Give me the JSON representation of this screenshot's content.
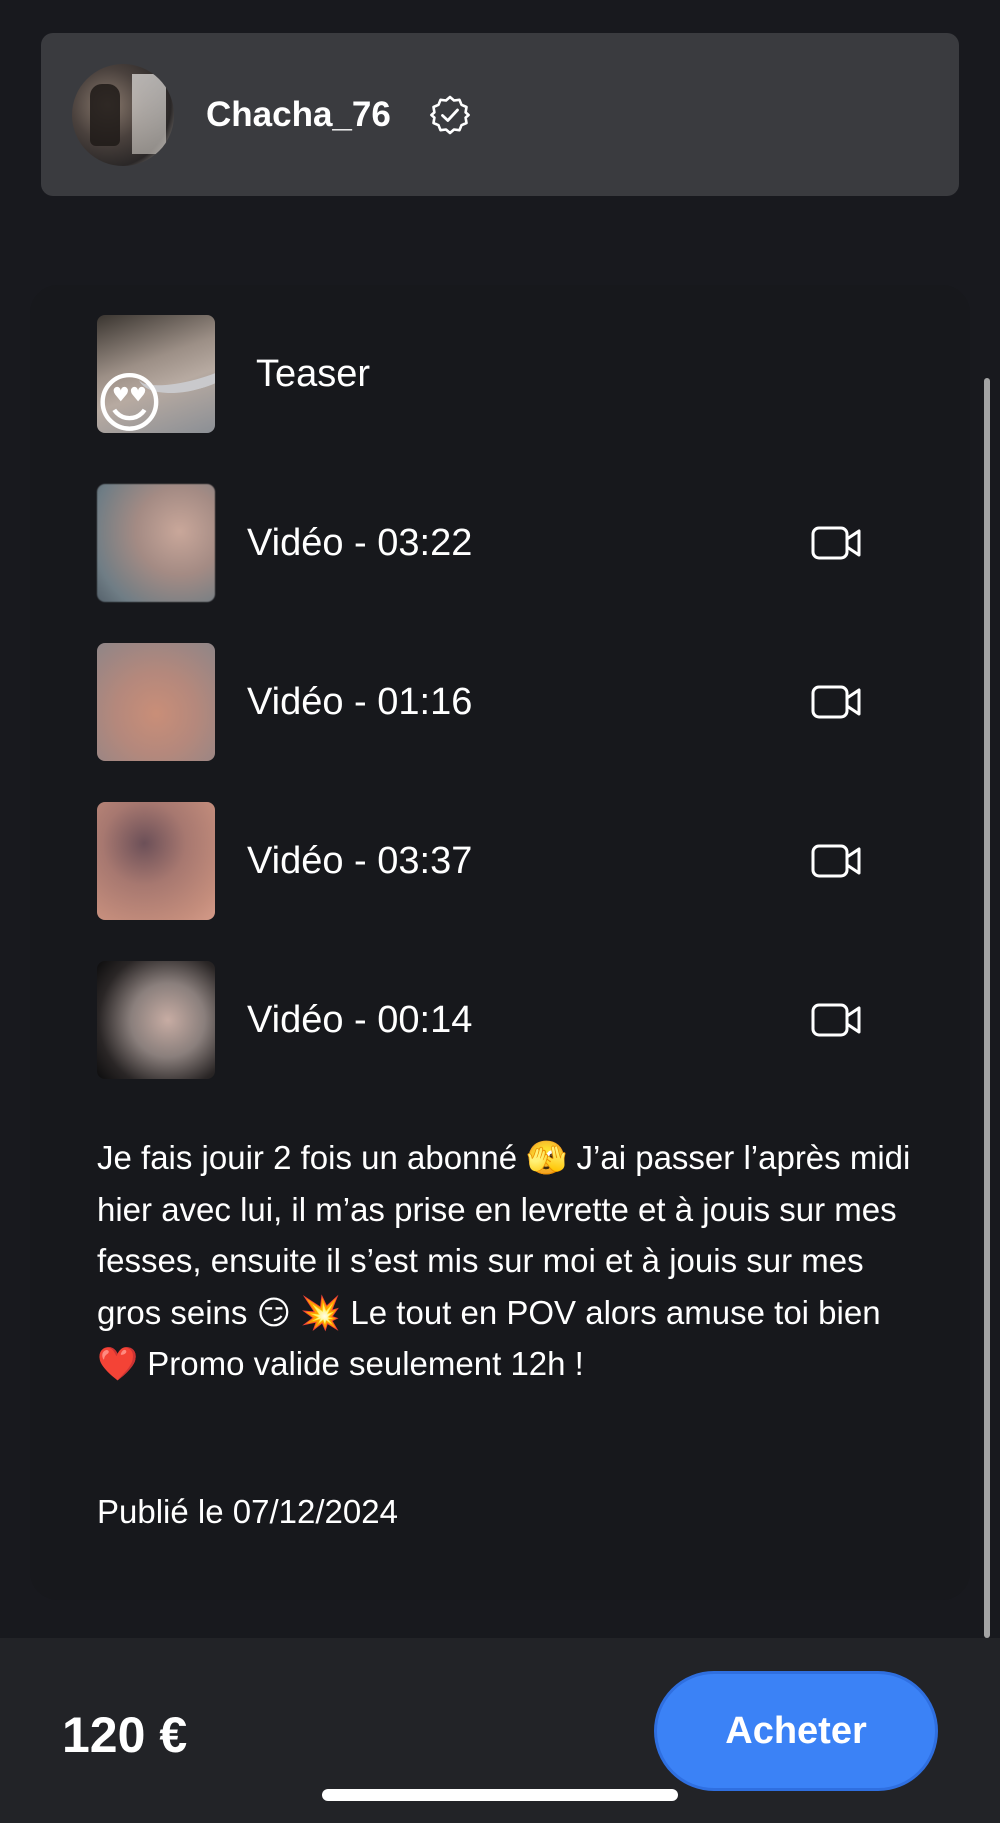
{
  "creator": {
    "username": "Chacha_76",
    "verified_icon": "verified-badge-icon"
  },
  "media": {
    "teaser_label": "Teaser",
    "teaser_emoji": "😍",
    "videos": [
      {
        "label": "Vidéo - 03:22",
        "icon": "video-camera-icon"
      },
      {
        "label": "Vidéo - 01:16",
        "icon": "video-camera-icon"
      },
      {
        "label": "Vidéo - 03:37",
        "icon": "video-camera-icon"
      },
      {
        "label": "Vidéo - 00:14",
        "icon": "video-camera-icon"
      }
    ]
  },
  "post": {
    "description_parts": [
      "Je fais jouir 2 fois un abonné ",
      "🫣",
      " J’ai passer l’après midi hier avec lui, il m’as prise en levrette et à jouis sur mes fesses, ensuite il s’est mis sur moi et à jouis sur mes gros seins ",
      "😏",
      " ",
      "💥",
      " Le tout en POV alors amuse toi bien ",
      "❤️",
      " Promo valide seulement 12h !"
    ],
    "published": "Publié le 07/12/2024"
  },
  "purchase": {
    "price": "120 €",
    "button_label": "Acheter",
    "button_color": "#3b82f6"
  }
}
